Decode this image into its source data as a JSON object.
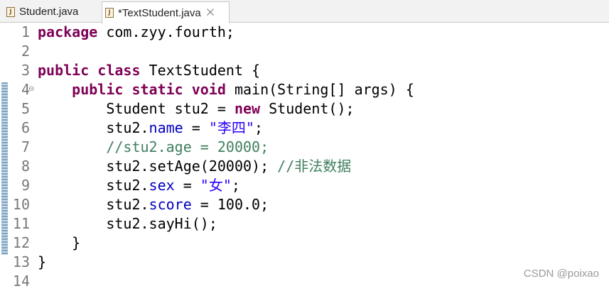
{
  "tabs": [
    {
      "label": "Student.java",
      "icon": "java-file-icon"
    },
    {
      "label": "*TextStudent.java",
      "icon": "java-file-icon",
      "close": "⨉"
    }
  ],
  "line_numbers": [
    "1",
    "2",
    "3",
    "4",
    "5",
    "6",
    "7",
    "8",
    "9",
    "10",
    "11",
    "12",
    "13",
    "14"
  ],
  "code": {
    "l1": {
      "kw": "package",
      "rest": " com.zyy.fourth;"
    },
    "l3": {
      "kw1": "public",
      "kw2": "class",
      "rest": " TextStudent {"
    },
    "l4": {
      "indent": "    ",
      "kw1": "public",
      "kw2": "static",
      "kw3": "void",
      "name": " main(String[] ",
      "param": "args",
      "rest": ") {"
    },
    "l5": {
      "indent": "        ",
      "pre": "Student ",
      "var": "stu2",
      "mid": " = ",
      "kw": "new",
      "rest": " Student();"
    },
    "l6": {
      "indent": "        ",
      "var": "stu2",
      "dot": ".",
      "field": "name",
      "mid": " = ",
      "str": "\"李四\"",
      "end": ";"
    },
    "l7": {
      "indent": "        ",
      "comment": "//stu2.age = 20000;"
    },
    "l8": {
      "indent": "        ",
      "pre": "stu2.setAge(20000); ",
      "comment": "//非法数据"
    },
    "l9": {
      "indent": "        ",
      "var": "stu2",
      "dot": ".",
      "field": "sex",
      "mid": " = ",
      "str": "\"女\"",
      "end": ";"
    },
    "l10": {
      "indent": "        ",
      "var": "stu2",
      "dot": ".",
      "field": "score",
      "mid": " = 100.0;"
    },
    "l11": {
      "indent": "        ",
      "pre": "stu2.sayHi();"
    },
    "l12": {
      "indent": "    ",
      "pre": "}"
    },
    "l13": {
      "pre": "}"
    }
  },
  "watermark": "CSDN @poixao"
}
